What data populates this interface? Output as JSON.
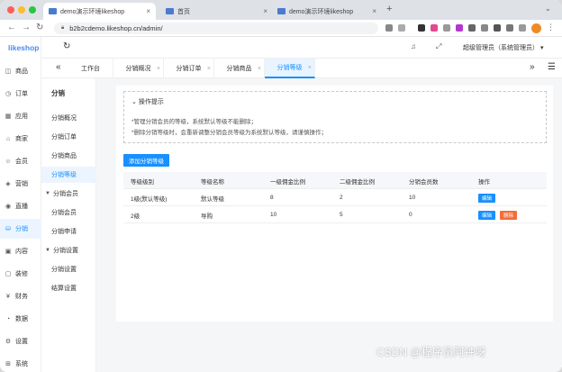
{
  "browser": {
    "tabs": [
      {
        "label": "demo演示环境likeshop",
        "active": true
      },
      {
        "label": "首页",
        "active": false
      },
      {
        "label": "demo演示环境likeshop",
        "active": false
      }
    ],
    "url": "b2b2cdemo.likeshop.cn/admin/"
  },
  "app": {
    "logo": "likeshop",
    "admin_label": "超级管理员（系统管理员）"
  },
  "sidebar": {
    "items": [
      {
        "label": "商品",
        "icon": "bag-icon"
      },
      {
        "label": "订单",
        "icon": "order-icon"
      },
      {
        "label": "应用",
        "icon": "apps-icon"
      },
      {
        "label": "商家",
        "icon": "shop-icon"
      },
      {
        "label": "会员",
        "icon": "user-icon"
      },
      {
        "label": "营销",
        "icon": "megaphone-icon"
      },
      {
        "label": "直播",
        "icon": "live-icon"
      },
      {
        "label": "分销",
        "icon": "distribution-icon"
      },
      {
        "label": "内容",
        "icon": "content-icon"
      },
      {
        "label": "装修",
        "icon": "brush-icon"
      },
      {
        "label": "财务",
        "icon": "yen-icon"
      },
      {
        "label": "数据",
        "icon": "chart-icon"
      },
      {
        "label": "设置",
        "icon": "gear-icon"
      },
      {
        "label": "系统",
        "icon": "system-icon"
      }
    ],
    "active_index": 7
  },
  "tagbar": {
    "tags": [
      "工作台",
      "分销概况",
      "分销订单",
      "分销商品",
      "分销等级"
    ],
    "active_index": 4
  },
  "submenu": {
    "title": "分销",
    "items": [
      {
        "label": "分销概况",
        "type": "item"
      },
      {
        "label": "分销订单",
        "type": "item"
      },
      {
        "label": "分销商品",
        "type": "item"
      },
      {
        "label": "分销等级",
        "type": "item",
        "active": true
      },
      {
        "label": "分销会员",
        "type": "group"
      },
      {
        "label": "分销会员",
        "type": "item"
      },
      {
        "label": "分销申请",
        "type": "item"
      },
      {
        "label": "分销设置",
        "type": "group"
      },
      {
        "label": "分销设置",
        "type": "item"
      },
      {
        "label": "结算设置",
        "type": "item"
      }
    ]
  },
  "tips": {
    "title": "操作提示",
    "lines": [
      "*管理分销会员的等级，系统默认等级不能删除；",
      "*删除分销等级时，会重新调整分销会员等级为系统默认等级，请谨慎操作；"
    ]
  },
  "add_button": "添加分销等级",
  "table": {
    "headers": [
      "等级级别",
      "等级名称",
      "一级佣金比例",
      "二级佣金比例",
      "分销会员数",
      "操作"
    ],
    "rows": [
      {
        "cells": [
          "1级(默认等级)",
          "默认等级",
          "8",
          "2",
          "10"
        ],
        "actions": [
          "编辑"
        ]
      },
      {
        "cells": [
          "2级",
          "导购",
          "10",
          "5",
          "0"
        ],
        "actions": [
          "编辑",
          "删除"
        ]
      }
    ]
  },
  "watermark": "CSDN @程序员阿钟呀",
  "colors": {
    "primary": "#1890ff",
    "danger": "#f56c3b"
  }
}
